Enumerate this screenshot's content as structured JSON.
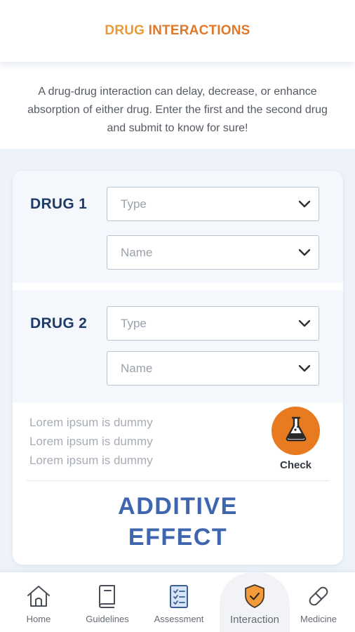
{
  "header": {
    "title_part1": "DRUG",
    "title_part2": "INTERACTIONS"
  },
  "intro_text": "A drug-drug interaction can delay, decrease, or enhance absorption of either drug. Enter the first and the second drug and submit to know for sure!",
  "drug1": {
    "label": "DRUG 1",
    "type_placeholder": "Type",
    "name_placeholder": "Name"
  },
  "drug2": {
    "label": "DRUG 2",
    "type_placeholder": "Type",
    "name_placeholder": "Name"
  },
  "lorem_lines": [
    "Lorem ipsum is dummy",
    "Lorem ipsum is dummy",
    "Lorem ipsum is dummy"
  ],
  "check": {
    "label": "Check",
    "icon": "flask-icon"
  },
  "result": {
    "line1": "ADDITIVE",
    "line2": "EFFECT"
  },
  "nav": {
    "items": [
      {
        "label": "Home",
        "icon": "home-icon"
      },
      {
        "label": "Guidelines",
        "icon": "book-icon"
      },
      {
        "label": "Assessment",
        "icon": "clipboard-icon"
      },
      {
        "label": "Interaction",
        "icon": "shield-check-icon",
        "active": true
      },
      {
        "label": "Medicine",
        "icon": "pill-icon"
      }
    ]
  },
  "colors": {
    "accent_orange": "#e87a1f",
    "title_orange": "#e0782a",
    "drug_label_navy": "#1f3c68",
    "result_blue": "#3e65ad"
  }
}
